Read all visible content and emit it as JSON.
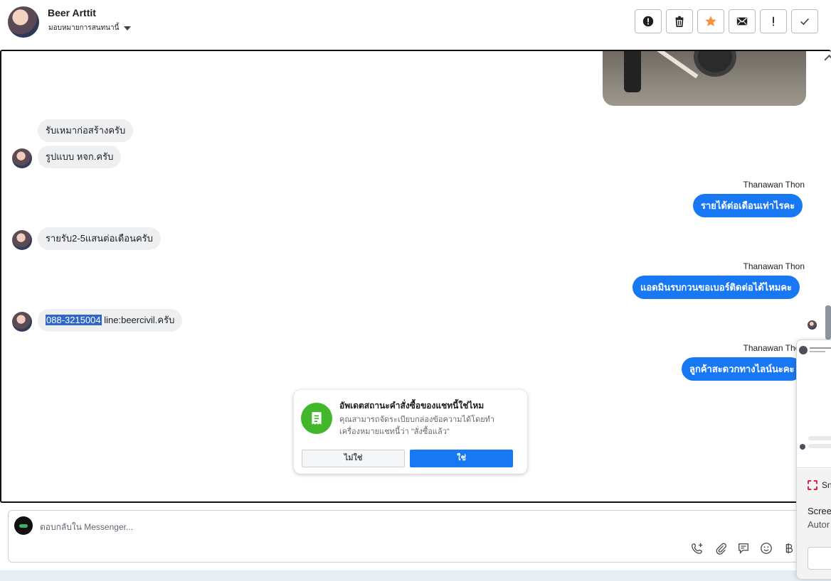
{
  "header": {
    "contact_name": "Beer Arttit",
    "assign_label": "มอบหมายการสนทนานี้",
    "toolbar": [
      {
        "name": "spam-button",
        "icon": "alert-circle-icon"
      },
      {
        "name": "delete-button",
        "icon": "trash-icon"
      },
      {
        "name": "star-button",
        "icon": "star-icon"
      },
      {
        "name": "mark-unread-button",
        "icon": "envelope-icon"
      },
      {
        "name": "follow-up-button",
        "icon": "exclamation-icon"
      },
      {
        "name": "done-button",
        "icon": "check-icon"
      }
    ]
  },
  "messages": {
    "in1": "รับเหมาก่อสร้างครับ",
    "in2": "รูปแบบ หจก.ครับ",
    "out1_sender": "Thanawan Thon",
    "out1": "รายได้ต่อเดือนเท่าไรคะ",
    "in3": "รายรับ2-5แสนต่อเดือนครับ",
    "out2_sender": "Thanawan Thon",
    "out2": "แอดมินรบกวนขอเบอร์ติดต่อได้ไหมคะ",
    "in4_phone": "088-3215004",
    "in4_rest": " line:beercivil.ครับ",
    "out3_sender": "Thanawan Thon",
    "out3": "ลูกค้าสะดวกทางไลน์นะคะ"
  },
  "prompt": {
    "title": "อัพเดตสถานะคำสั่งซื้อของแชทนี้ใช่ไหม",
    "description": "คุณสามารถจัดระเบียบกล่องข้อความได้โดยทำเครื่องหมายแชทนี้ว่า \"สั่งซื้อแล้ว\"",
    "no_label": "ไม่ใช่",
    "yes_label": "ใช่"
  },
  "composer": {
    "placeholder": "ตอบกลับใน Messenger..."
  },
  "snip_overlay": {
    "app_name": "Sn",
    "line1": "Scree",
    "line2": "Autor"
  },
  "colors": {
    "accent": "#1877f2",
    "incoming_bubble": "#eeeff1",
    "order_icon": "#42b72a",
    "star": "#f7923a"
  }
}
